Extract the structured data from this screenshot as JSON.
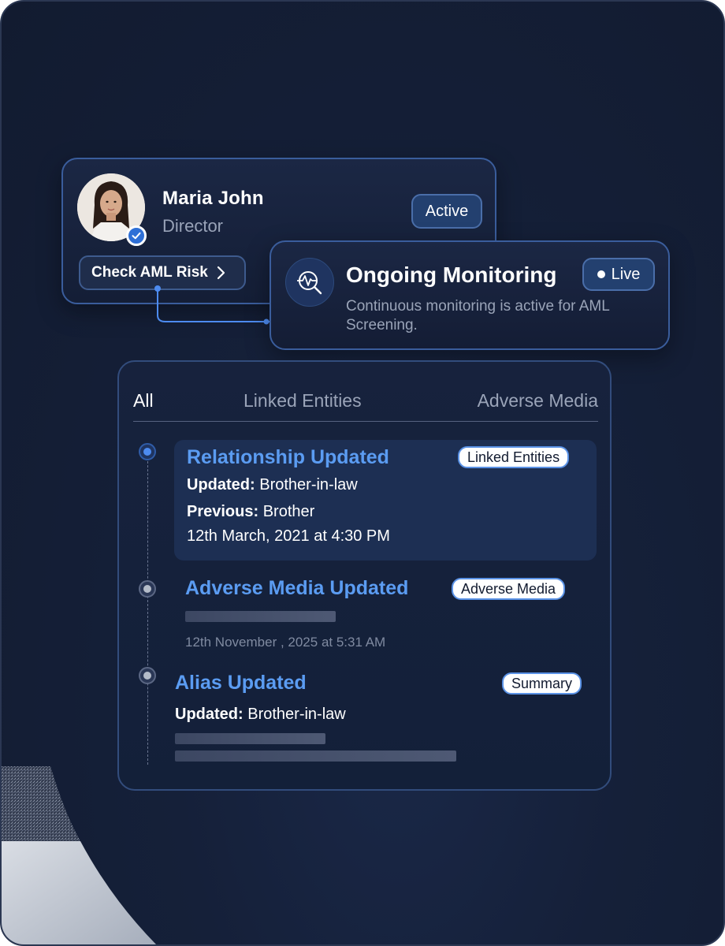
{
  "profile": {
    "name": "Maria John",
    "role": "Director",
    "status": "Active",
    "action_label": "Check AML Risk",
    "action_icon": "chevron-right-icon",
    "verified_icon": "check-circle-icon"
  },
  "monitoring": {
    "title": "Ongoing Monitoring",
    "live_label": "Live",
    "description": "Continuous monitoring is active for AML Screening.",
    "icon": "pulse-search-icon"
  },
  "tabs": [
    {
      "label": "All",
      "active": true
    },
    {
      "label": "Linked Entities",
      "active": false
    },
    {
      "label": "Adverse Media",
      "active": false
    }
  ],
  "events": [
    {
      "title": "Relationship Updated",
      "tag": "Linked Entities",
      "updated_label": "Updated:",
      "updated_value": "Brother-in-law",
      "previous_label": "Previous:",
      "previous_value": "Brother",
      "date": "12th March, 2021 at 4:30 PM"
    },
    {
      "title": "Adverse Media Updated",
      "tag": "Adverse Media",
      "date": "12th November , 2025 at 5:31 AM"
    },
    {
      "title": "Alias Updated",
      "tag": "Summary",
      "updated_label": "Updated:",
      "updated_value": "Brother-in-law"
    }
  ],
  "colors": {
    "accent": "#5b9cf2",
    "background": "#121b30",
    "card_border": "#3a5d9c"
  }
}
